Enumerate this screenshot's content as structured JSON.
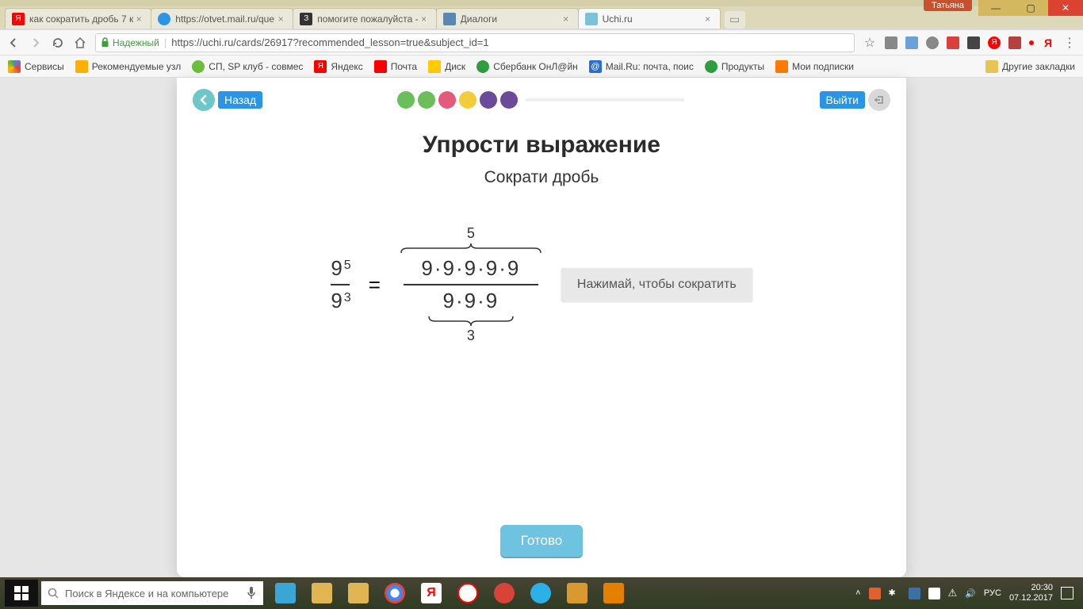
{
  "window": {
    "user_badge": "Татьяна"
  },
  "tabs": [
    {
      "title": "как сократить дробь 7 к",
      "favicon": "#ff0000"
    },
    {
      "title": "https://otvet.mail.ru/que",
      "favicon": "#2a94e6"
    },
    {
      "title": "помогите пожалуйста -",
      "favicon": "#333333"
    },
    {
      "title": "Диалоги",
      "favicon": "#5a88b5"
    },
    {
      "title": "Uchi.ru",
      "favicon": "#7ac3d8",
      "active": true
    }
  ],
  "address": {
    "secure_label": "Надежный",
    "url": "https://uchi.ru/cards/26917?recommended_lesson=true&subject_id=1"
  },
  "bookmarks": {
    "items": [
      {
        "label": "Сервисы",
        "color": "#6a6a6a"
      },
      {
        "label": "Рекомендуемые узл",
        "color": "#ffb000"
      },
      {
        "label": "СП, SP клуб - совмес",
        "color": "#6bbf3b"
      },
      {
        "label": "Яндекс",
        "color": "#ff0000"
      },
      {
        "label": "Почта",
        "color": "#ff0000"
      },
      {
        "label": "Диск",
        "color": "#ffcc00"
      },
      {
        "label": "Сбербанк ОнЛ@йн",
        "color": "#2e9e3f"
      },
      {
        "label": "Mail.Ru: почта, поис",
        "color": "#2a6fd6"
      },
      {
        "label": "Продукты",
        "color": "#2e9e3f"
      },
      {
        "label": "Мои подписки",
        "color": "#ff7a00"
      }
    ],
    "other": "Другие закладки"
  },
  "lesson": {
    "back_label": "Назад",
    "exit_label": "Выйти",
    "dot_colors": [
      "#6bbf5a",
      "#6bbf5a",
      "#e35a7a",
      "#f2cc3c",
      "#6b4a99",
      "#6b4a99"
    ],
    "title": "Упрости выражение",
    "subtitle": "Сократи дробь",
    "frac_base": "9",
    "frac_num_exp": "5",
    "frac_den_exp": "3",
    "equals": "=",
    "expand_top_count": "5",
    "expand_num": "9·9·9·9·9",
    "expand_den": "9·9·9",
    "expand_bot_count": "3",
    "hint": "Нажимай, чтобы сократить",
    "done": "Готово"
  },
  "taskbar": {
    "search_placeholder": "Поиск в Яндексе и на компьютере",
    "apps": [
      {
        "name": "speaker",
        "color": "#3ba6d6"
      },
      {
        "name": "folder1",
        "color": "#e0b552"
      },
      {
        "name": "folder2",
        "color": "#e0b552"
      },
      {
        "name": "chrome",
        "color": "#ffffff"
      },
      {
        "name": "yandex-y",
        "color": "#ffffff"
      },
      {
        "name": "yandex-browser",
        "color": "#ffffff"
      },
      {
        "name": "opera",
        "color": "#d84338"
      },
      {
        "name": "skype",
        "color": "#2cb0e8"
      },
      {
        "name": "tool",
        "color": "#d89a2e"
      },
      {
        "name": "picmgr",
        "color": "#e57f00"
      }
    ],
    "lang": "РУС",
    "time": "20:30",
    "date": "07.12.2017"
  }
}
